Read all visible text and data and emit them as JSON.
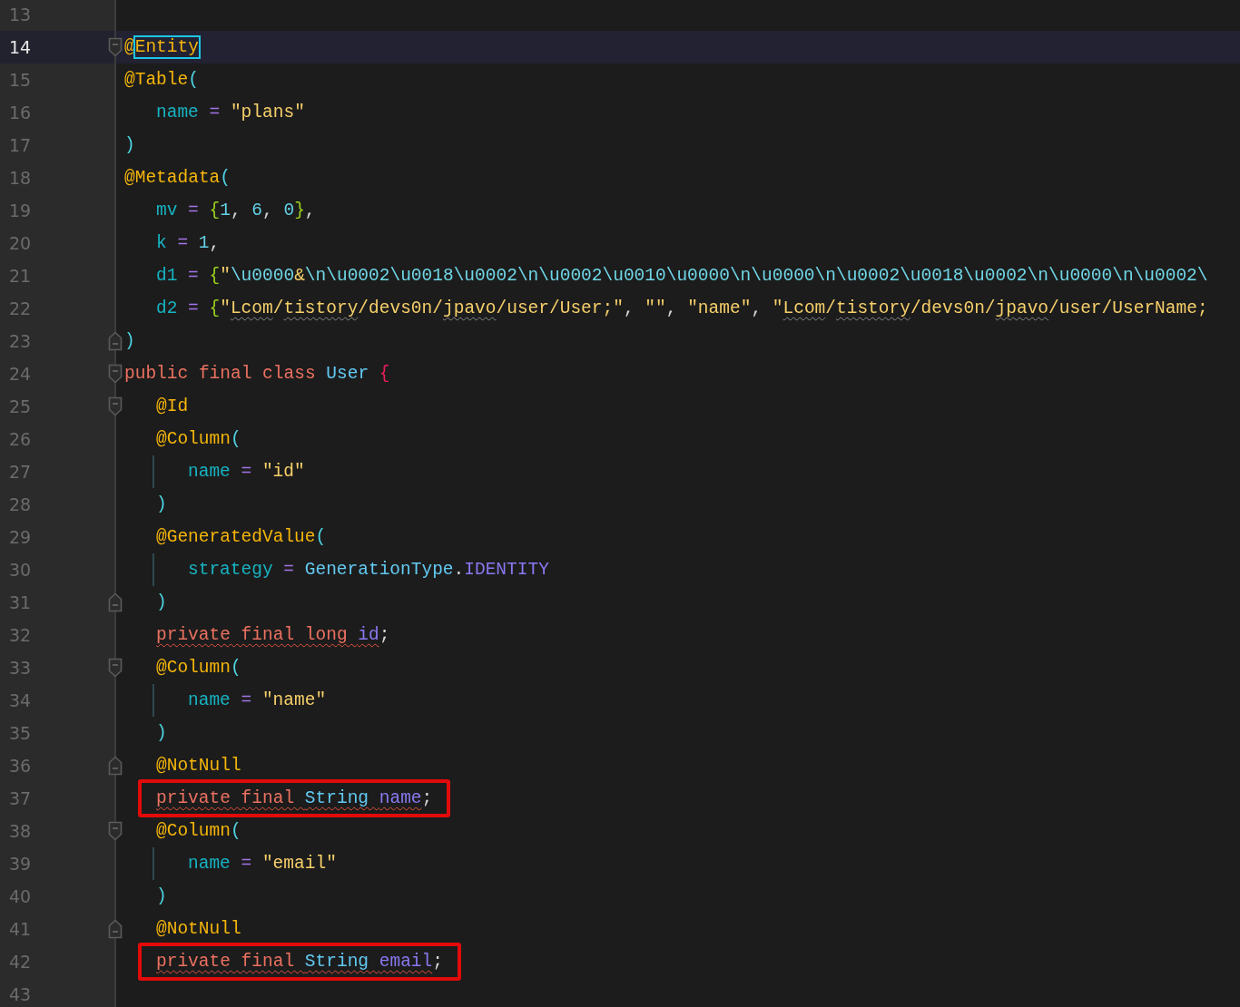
{
  "editor": {
    "lines": [
      {
        "number": "13",
        "current": false,
        "fold_start": false,
        "fold_end": false
      },
      {
        "number": "14",
        "current": true,
        "boxed": false,
        "fold_start": true,
        "fold_end": false,
        "tokens": [
          {
            "text": "@",
            "kind": "annotation",
            "squiggle": false,
            "outlined": false
          },
          {
            "text": "Entity",
            "kind": "annotation",
            "squiggle": false,
            "outlined": true
          }
        ]
      },
      {
        "number": "15",
        "current": false,
        "boxed": false,
        "fold_start": false,
        "fold_end": false,
        "tokens": [
          {
            "text": "@Table",
            "kind": "annotation",
            "squiggle": false
          },
          {
            "text": "(",
            "kind": "paren",
            "squiggle": false
          }
        ],
        "children": [
          {
            "number": "16",
            "current": false,
            "boxed": false,
            "fold_start": false,
            "fold_end": false,
            "tokens": [
              {
                "text": "name",
                "kind": "param",
                "squiggle": false
              },
              {
                "text": " = ",
                "kind": "op",
                "squiggle": false
              },
              {
                "text": "\"plans\"",
                "kind": "string",
                "squiggle": false
              }
            ]
          }
        ]
      },
      {
        "number": "17",
        "current": false,
        "boxed": false,
        "fold_start": false,
        "fold_end": false,
        "tokens": [
          {
            "text": ")",
            "kind": "paren",
            "squiggle": false
          }
        ]
      },
      {
        "number": "18",
        "current": false,
        "boxed": false,
        "fold_start": false,
        "fold_end": false,
        "tokens": [
          {
            "text": "@Metadata",
            "kind": "annotation",
            "squiggle": false
          },
          {
            "text": "(",
            "kind": "paren",
            "squiggle": false
          }
        ],
        "children": [
          {
            "number": "19",
            "current": false,
            "boxed": false,
            "fold_start": false,
            "fold_end": false,
            "tokens": [
              {
                "text": "mv",
                "kind": "param",
                "squiggle": false
              },
              {
                "text": " = ",
                "kind": "op",
                "squiggle": false
              },
              {
                "text": "{",
                "kind": "brace",
                "squiggle": false
              },
              {
                "text": "1",
                "kind": "number",
                "squiggle": false
              },
              {
                "text": ", ",
                "kind": "plain",
                "squiggle": false
              },
              {
                "text": "6",
                "kind": "number",
                "squiggle": false
              },
              {
                "text": ", ",
                "kind": "plain",
                "squiggle": false
              },
              {
                "text": "0",
                "kind": "number",
                "squiggle": false
              },
              {
                "text": "}",
                "kind": "brace",
                "squiggle": false
              },
              {
                "text": ",",
                "kind": "plain",
                "squiggle": false
              }
            ]
          },
          {
            "number": "20",
            "current": false,
            "boxed": false,
            "fold_start": false,
            "fold_end": false,
            "tokens": [
              {
                "text": "k",
                "kind": "param",
                "squiggle": false
              },
              {
                "text": " = ",
                "kind": "op",
                "squiggle": false
              },
              {
                "text": "1",
                "kind": "number",
                "squiggle": false
              },
              {
                "text": ",",
                "kind": "plain",
                "squiggle": false
              }
            ]
          },
          {
            "number": "21",
            "current": false,
            "boxed": false,
            "fold_start": false,
            "fold_end": false,
            "tokens": [
              {
                "text": "d1",
                "kind": "param",
                "squiggle": false
              },
              {
                "text": " = ",
                "kind": "op",
                "squiggle": false
              },
              {
                "text": "{",
                "kind": "brace",
                "squiggle": false
              },
              {
                "text": "\"",
                "kind": "string",
                "squiggle": false
              },
              {
                "text": "\\u0000",
                "kind": "escape",
                "squiggle": false
              },
              {
                "text": "&",
                "kind": "string",
                "squiggle": false
              },
              {
                "text": "\\n\\u0002\\u0018\\u0002\\n\\u0002\\u0010\\u0000\\n\\u0000\\n\\u0002\\u0018\\u0002\\n\\u0000\\n\\u0002\\",
                "kind": "escape",
                "squiggle": false
              }
            ]
          },
          {
            "number": "22",
            "current": false,
            "boxed": false,
            "fold_start": false,
            "fold_end": false,
            "tokens": [
              {
                "text": "d2",
                "kind": "param",
                "squiggle": false
              },
              {
                "text": " = ",
                "kind": "op",
                "squiggle": false
              },
              {
                "text": "{",
                "kind": "brace",
                "squiggle": false
              },
              {
                "text": "\"",
                "kind": "string",
                "squiggle": false
              },
              {
                "text": "Lcom",
                "kind": "string",
                "squiggle": true
              },
              {
                "text": "/",
                "kind": "string",
                "squiggle": false
              },
              {
                "text": "tistory",
                "kind": "string",
                "squiggle": true
              },
              {
                "text": "/devs0n/",
                "kind": "string",
                "squiggle": false
              },
              {
                "text": "jpavo",
                "kind": "string",
                "squiggle": true
              },
              {
                "text": "/user/User;\"",
                "kind": "string",
                "squiggle": false
              },
              {
                "text": ", ",
                "kind": "plain",
                "squiggle": false
              },
              {
                "text": "\"\"",
                "kind": "string",
                "squiggle": false
              },
              {
                "text": ", ",
                "kind": "plain",
                "squiggle": false
              },
              {
                "text": "\"name\"",
                "kind": "string",
                "squiggle": false
              },
              {
                "text": ", ",
                "kind": "plain",
                "squiggle": false
              },
              {
                "text": "\"",
                "kind": "string",
                "squiggle": false
              },
              {
                "text": "Lcom",
                "kind": "string",
                "squiggle": true
              },
              {
                "text": "/",
                "kind": "string",
                "squiggle": false
              },
              {
                "text": "tistory",
                "kind": "string",
                "squiggle": true
              },
              {
                "text": "/devs0n/",
                "kind": "string",
                "squiggle": false
              },
              {
                "text": "jpavo",
                "kind": "string",
                "squiggle": true
              },
              {
                "text": "/user/UserName;",
                "kind": "string",
                "squiggle": false
              }
            ]
          }
        ]
      },
      {
        "number": "23",
        "current": false,
        "boxed": false,
        "fold_start": false,
        "fold_end": true,
        "tokens": [
          {
            "text": ")",
            "kind": "paren",
            "squiggle": false
          }
        ]
      },
      {
        "number": "24",
        "current": false,
        "boxed": false,
        "fold_start": true,
        "fold_end": false,
        "tokens": [
          {
            "text": "public final class ",
            "kind": "keyword",
            "squiggle": false
          },
          {
            "text": "User ",
            "kind": "type",
            "squiggle": false
          },
          {
            "text": "{",
            "kind": "classbrace",
            "squiggle": false
          }
        ],
        "children": [
          {
            "number": "25",
            "current": false,
            "boxed": false,
            "fold_start": true,
            "fold_end": false,
            "tokens": [
              {
                "text": "@Id",
                "kind": "annotation",
                "squiggle": false
              }
            ]
          },
          {
            "number": "26",
            "current": false,
            "boxed": false,
            "fold_start": false,
            "fold_end": false,
            "tokens": [
              {
                "text": "@Column",
                "kind": "annotation",
                "squiggle": false
              },
              {
                "text": "(",
                "kind": "paren",
                "squiggle": false
              }
            ],
            "children": [
              {
                "number": "27",
                "current": false,
                "boxed": false,
                "fold_start": false,
                "fold_end": false,
                "tokens": [
                  {
                    "text": "name",
                    "kind": "param",
                    "squiggle": false
                  },
                  {
                    "text": " = ",
                    "kind": "op",
                    "squiggle": false
                  },
                  {
                    "text": "\"id\"",
                    "kind": "string",
                    "squiggle": false
                  }
                ]
              }
            ]
          },
          {
            "number": "28",
            "current": false,
            "boxed": false,
            "fold_start": false,
            "fold_end": false,
            "tokens": [
              {
                "text": ")",
                "kind": "paren",
                "squiggle": false
              }
            ]
          },
          {
            "number": "29",
            "current": false,
            "boxed": false,
            "fold_start": false,
            "fold_end": false,
            "tokens": [
              {
                "text": "@GeneratedValue",
                "kind": "annotation",
                "squiggle": false
              },
              {
                "text": "(",
                "kind": "paren",
                "squiggle": false
              }
            ],
            "children": [
              {
                "number": "30",
                "current": false,
                "boxed": false,
                "fold_start": false,
                "fold_end": false,
                "tokens": [
                  {
                    "text": "strategy",
                    "kind": "param",
                    "squiggle": false
                  },
                  {
                    "text": " = ",
                    "kind": "op",
                    "squiggle": false
                  },
                  {
                    "text": "GenerationType",
                    "kind": "type",
                    "squiggle": false
                  },
                  {
                    "text": ".",
                    "kind": "plain",
                    "squiggle": false
                  },
                  {
                    "text": "IDENTITY",
                    "kind": "field",
                    "squiggle": false
                  }
                ]
              }
            ]
          },
          {
            "number": "31",
            "current": false,
            "boxed": false,
            "fold_start": false,
            "fold_end": true,
            "tokens": [
              {
                "text": ")",
                "kind": "paren",
                "squiggle": false
              }
            ]
          },
          {
            "number": "32",
            "current": false,
            "boxed": false,
            "fold_start": false,
            "fold_end": false,
            "tokens": [
              {
                "text": "private final long ",
                "kind": "keyword",
                "squiggle": true
              },
              {
                "text": "id",
                "kind": "field",
                "squiggle": true
              },
              {
                "text": ";",
                "kind": "plain",
                "squiggle": false
              }
            ]
          },
          {
            "number": "33",
            "current": false,
            "boxed": false,
            "fold_start": true,
            "fold_end": false,
            "tokens": [
              {
                "text": "@Column",
                "kind": "annotation",
                "squiggle": false
              },
              {
                "text": "(",
                "kind": "paren",
                "squiggle": false
              }
            ],
            "children": [
              {
                "number": "34",
                "current": false,
                "boxed": false,
                "fold_start": false,
                "fold_end": false,
                "tokens": [
                  {
                    "text": "name",
                    "kind": "param",
                    "squiggle": false
                  },
                  {
                    "text": " = ",
                    "kind": "op",
                    "squiggle": false
                  },
                  {
                    "text": "\"name\"",
                    "kind": "string",
                    "squiggle": false
                  }
                ]
              }
            ]
          },
          {
            "number": "35",
            "current": false,
            "boxed": false,
            "fold_start": false,
            "fold_end": false,
            "tokens": [
              {
                "text": ")",
                "kind": "paren",
                "squiggle": false
              }
            ]
          },
          {
            "number": "36",
            "current": false,
            "boxed": false,
            "fold_start": false,
            "fold_end": true,
            "tokens": [
              {
                "text": "@NotNull",
                "kind": "annotation",
                "squiggle": false
              }
            ]
          },
          {
            "number": "37",
            "current": false,
            "boxed": true,
            "fold_start": false,
            "fold_end": false,
            "tokens": [
              {
                "text": "private final ",
                "kind": "keyword",
                "squiggle": true
              },
              {
                "text": "String ",
                "kind": "type",
                "squiggle": true
              },
              {
                "text": "name",
                "kind": "field",
                "squiggle": true
              },
              {
                "text": ";",
                "kind": "plain",
                "squiggle": false
              }
            ]
          },
          {
            "number": "38",
            "current": false,
            "boxed": false,
            "fold_start": true,
            "fold_end": false,
            "tokens": [
              {
                "text": "@Column",
                "kind": "annotation",
                "squiggle": false
              },
              {
                "text": "(",
                "kind": "paren",
                "squiggle": false
              }
            ],
            "children": [
              {
                "number": "39",
                "current": false,
                "boxed": false,
                "fold_start": false,
                "fold_end": false,
                "tokens": [
                  {
                    "text": "name",
                    "kind": "param",
                    "squiggle": false
                  },
                  {
                    "text": " = ",
                    "kind": "op",
                    "squiggle": false
                  },
                  {
                    "text": "\"email\"",
                    "kind": "string",
                    "squiggle": false
                  }
                ]
              }
            ]
          },
          {
            "number": "40",
            "current": false,
            "boxed": false,
            "fold_start": false,
            "fold_end": false,
            "tokens": [
              {
                "text": ")",
                "kind": "paren",
                "squiggle": false
              }
            ]
          },
          {
            "number": "41",
            "current": false,
            "boxed": false,
            "fold_start": false,
            "fold_end": true,
            "tokens": [
              {
                "text": "@NotNull",
                "kind": "annotation",
                "squiggle": false
              }
            ]
          },
          {
            "number": "42",
            "current": false,
            "boxed": true,
            "fold_start": false,
            "fold_end": false,
            "tokens": [
              {
                "text": "private final ",
                "kind": "keyword",
                "squiggle": true
              },
              {
                "text": "String ",
                "kind": "type",
                "squiggle": true
              },
              {
                "text": "email",
                "kind": "field",
                "squiggle": true
              },
              {
                "text": ";",
                "kind": "plain",
                "squiggle": false
              }
            ]
          }
        ]
      },
      {
        "number": "43",
        "current": false,
        "fold_start": false,
        "fold_end": false
      }
    ]
  }
}
